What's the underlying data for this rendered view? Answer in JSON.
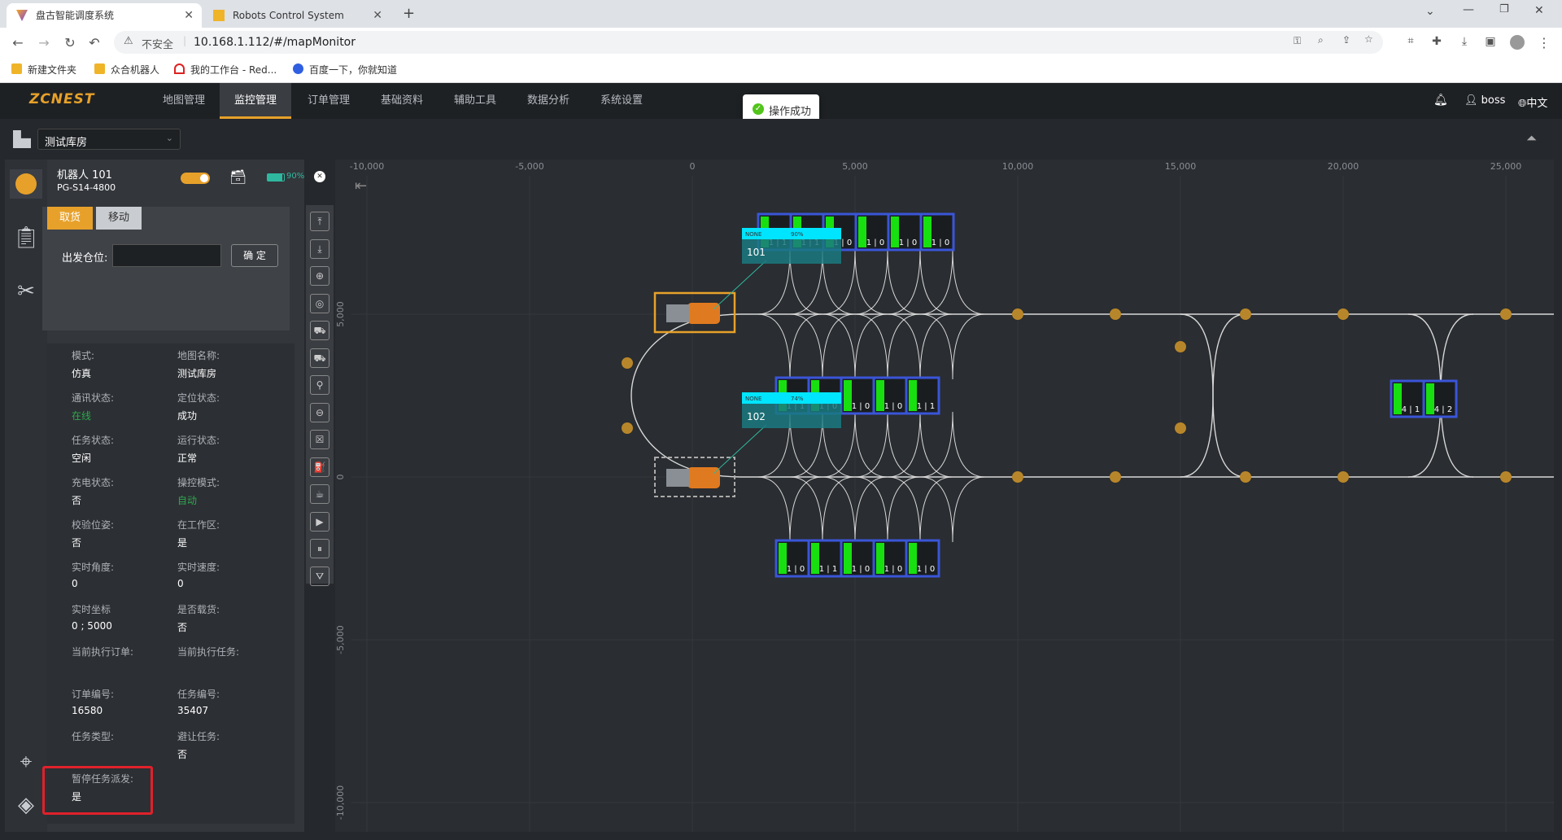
{
  "browser": {
    "tabs": [
      {
        "title": "盘古智能调度系统",
        "active": true
      },
      {
        "title": "Robots Control System",
        "active": false
      }
    ],
    "security_label": "不安全",
    "url": "10.168.1.112/#/mapMonitor",
    "bookmarks": [
      "新建文件夹",
      "众合机器人",
      "我的工作台 - Red...",
      "百度一下，你就知道"
    ]
  },
  "app": {
    "logo": "ZCNEST",
    "nav": [
      "地图管理",
      "监控管理",
      "订单管理",
      "基础资料",
      "辅助工具",
      "数据分析",
      "系统设置"
    ],
    "active_nav": "监控管理",
    "toast": "操作成功",
    "user": "boss",
    "language": "中文",
    "warehouse": "测试库房"
  },
  "robot": {
    "name": "机器人  101",
    "model": "PG-S14-4800",
    "battery": "90%",
    "battery_fraction": 0.9,
    "tab_pick": "取货",
    "tab_move": "移动",
    "start_label": "出发仓位:",
    "confirm": "确 定"
  },
  "details": [
    {
      "label": "模式:",
      "value": "仿真"
    },
    {
      "label": "地图名称:",
      "value": "测试库房"
    },
    {
      "label": "通讯状态:",
      "value": "在线",
      "color": "#2fa84f"
    },
    {
      "label": "定位状态:",
      "value": "成功"
    },
    {
      "label": "任务状态:",
      "value": "空闲"
    },
    {
      "label": "运行状态:",
      "value": "正常"
    },
    {
      "label": "充电状态:",
      "value": "否"
    },
    {
      "label": "操控模式:",
      "value": "自动",
      "color": "#2fa84f"
    },
    {
      "label": "校验位姿:",
      "value": "否"
    },
    {
      "label": "在工作区:",
      "value": "是"
    },
    {
      "label": "实时角度:",
      "value": "0"
    },
    {
      "label": "实时速度:",
      "value": "0"
    },
    {
      "label": "实时坐标",
      "value": "0  ;  5000"
    },
    {
      "label": "是否载货:",
      "value": "否"
    },
    {
      "label": "当前执行订单:",
      "value": ""
    },
    {
      "label": "当前执行任务:",
      "value": ""
    },
    {
      "label": "订单编号:",
      "value": "16580"
    },
    {
      "label": "任务编号:",
      "value": "35407"
    },
    {
      "label": "任务类型:",
      "value": ""
    },
    {
      "label": "避让任务:",
      "value": "否"
    },
    {
      "label": "暂停任务派发:",
      "value": "是"
    }
  ],
  "map": {
    "x_ticks": [
      "-10,000",
      "-5,000",
      "0",
      "5,000",
      "10,000",
      "15,000",
      "20,000",
      "25,000"
    ],
    "y_ticks": [
      "5,000",
      "0",
      "-5,000",
      "-10,000"
    ],
    "robots": [
      {
        "id": "101",
        "tag": "NONE",
        "battery": "90%"
      },
      {
        "id": "102",
        "tag": "NONE",
        "battery": "74%"
      }
    ],
    "rack_labels_top": [
      "1 | 1",
      "1 | 1",
      "1 | 0",
      "1 | 0",
      "1 | 0",
      "1 | 0"
    ],
    "rack_labels_mid": [
      "1 | 1",
      "1 | 0",
      "1 | 0",
      "1 | 0",
      "1 | 1"
    ],
    "rack_labels_bot": [
      "1 | 0",
      "1 | 1",
      "1 | 0",
      "1 | 0",
      "1 | 0"
    ],
    "rack_labels_right": [
      "4 | 1",
      "4 | 2"
    ]
  }
}
